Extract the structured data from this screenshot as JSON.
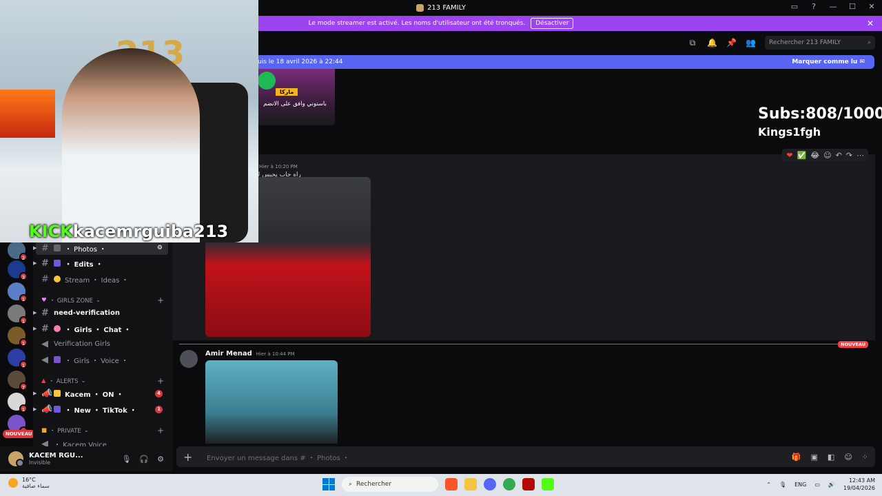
{
  "window": {
    "title": "213 FAMILY",
    "controls": [
      "▭",
      "?",
      "—",
      "☐",
      "✕"
    ]
  },
  "banner": {
    "text": "Le mode streamer est activé. Les noms d'utilisateur ont été tronqués.",
    "button": "Désactiver",
    "close": "✕"
  },
  "header": {
    "search_placeholder": "Rechercher 213 FAMILY"
  },
  "new_messages_bar": {
    "text": "uis le 18 avril 2026 à 22:44",
    "mark_read": "Marquer comme lu"
  },
  "overlay": {
    "subs": "Subs:808/1000",
    "name": "Kings1fgh",
    "kick": "KICK",
    "channel": "kacemrguiba213"
  },
  "messages": [
    {
      "timestamp": "Hier à 10:20 PM",
      "text": "راه حاب يحبس ك"
    },
    {
      "author": "Amir Menad",
      "timestamp": "Hier à 10:44 PM"
    }
  ],
  "spotify_card": {
    "tag": "ماركا",
    "text": "باستوني وافق على الانضم"
  },
  "divider_label": "NOUVEAU",
  "reactions": [
    "❤",
    "✅",
    "😂",
    "☺",
    "↶",
    "↷",
    "⋯"
  ],
  "servers": {
    "badges": [
      "2",
      "3",
      "1",
      "1",
      "1",
      "1",
      "7",
      "1",
      "1"
    ],
    "nouveau": "NOUVEAU"
  },
  "channels": [
    {
      "type": "channel",
      "label": "・ Photos ・",
      "active": true
    },
    {
      "type": "channel",
      "label": "・ Edits ・",
      "bold": true
    },
    {
      "type": "channel",
      "label": "Stream ・ Ideas ・"
    },
    {
      "type": "category",
      "label": "・ GIRLS ZONE"
    },
    {
      "type": "channel",
      "label": "need-verification",
      "bold": true
    },
    {
      "type": "channel",
      "label": "・ Girls ・ Chat ・",
      "bold": true
    },
    {
      "type": "voice",
      "label": "Verification Girls"
    },
    {
      "type": "voice",
      "label": "・ Girls ・ Voice ・"
    },
    {
      "type": "category",
      "label": "・ ALERTS"
    },
    {
      "type": "announce",
      "label": "Kacem ・ ON ・",
      "badge": "4",
      "bold": true
    },
    {
      "type": "announce",
      "label": "・ New ・ TikTok ・",
      "badge": "1",
      "bold": true
    },
    {
      "type": "category",
      "label": "・ Private"
    },
    {
      "type": "voice",
      "label": "・ Kacem Voice"
    }
  ],
  "user": {
    "name": "KACEM RGU...",
    "status": "Invisible"
  },
  "composer": {
    "placeholder": "Envoyer un message dans #  ・ Photos ・"
  },
  "taskbar": {
    "temp": "16°C",
    "weather": "سماء صافية",
    "search": "Rechercher",
    "lang": "ENG",
    "time": "12:43 AM",
    "date": "19/04/2026"
  },
  "colors": {
    "banner": "#9b44f0",
    "new_bar": "#5865f2",
    "kick_green": "#53fc18",
    "badge_red": "#da373c"
  }
}
